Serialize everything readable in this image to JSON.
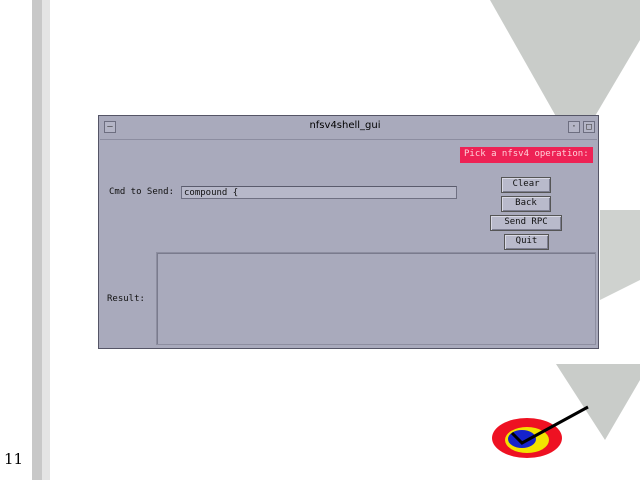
{
  "slide": {
    "number": "11"
  },
  "window": {
    "title": "nfsv4shell_gui",
    "menu_icon": "window-menu-icon",
    "minimize_icon": "minimize-icon",
    "maximize_icon": "maximize-icon"
  },
  "form": {
    "operation_label": "Pick a nfsv4 operation:",
    "cmd_label": "Cmd to Send:",
    "cmd_value": "compound {",
    "result_label": "Result:",
    "result_value": ""
  },
  "buttons": {
    "clear": "Clear",
    "back": "Back",
    "send_rpc": "Send RPC",
    "quit": "Quit"
  },
  "colors": {
    "window_bg": "#a9aabc",
    "operation_bg": "#ee2255"
  }
}
